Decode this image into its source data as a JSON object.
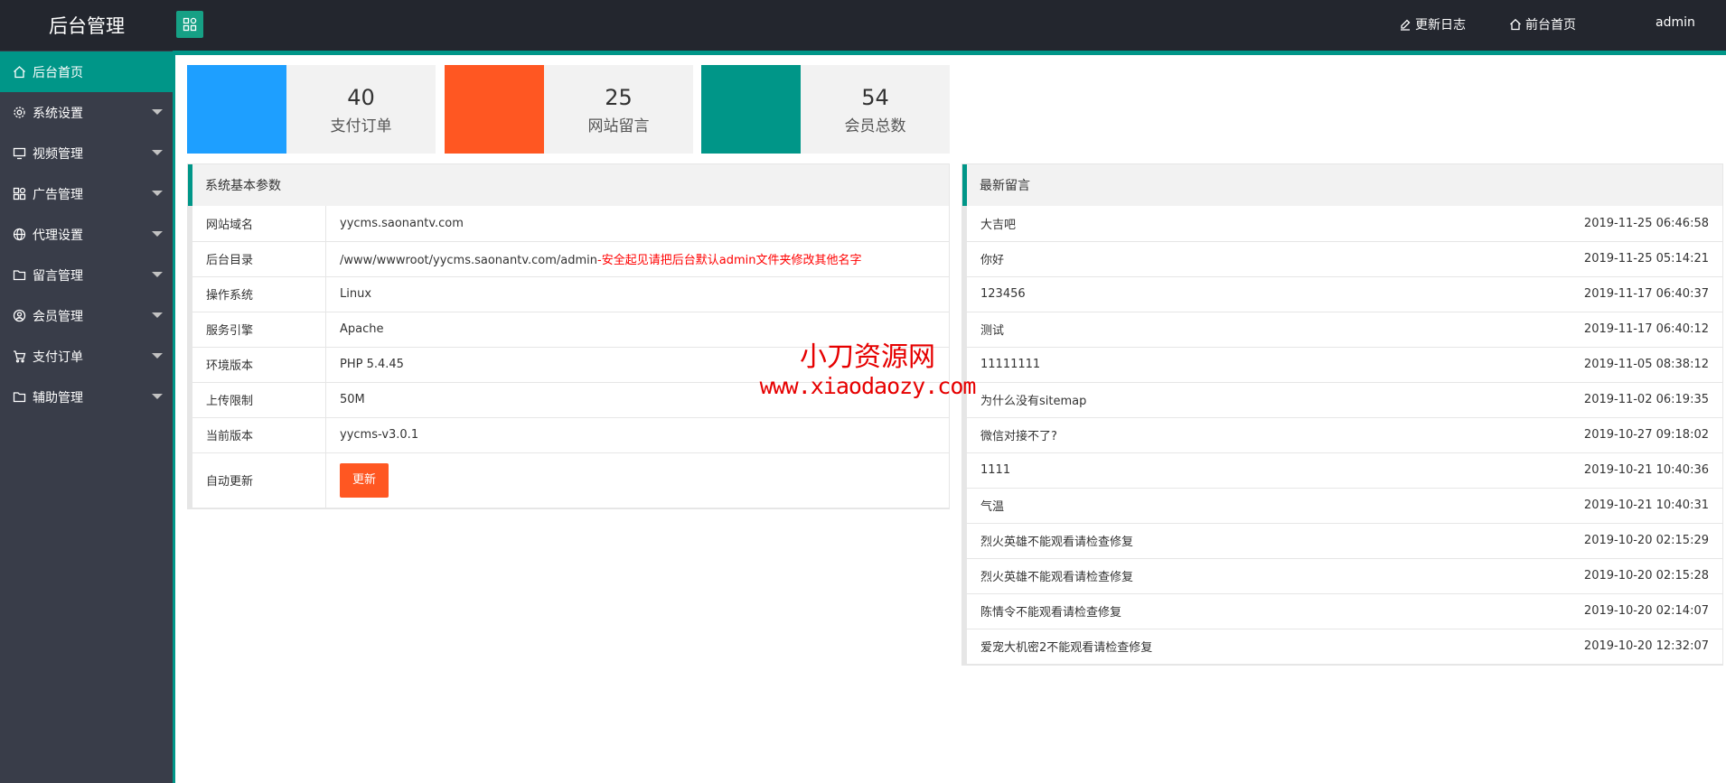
{
  "header": {
    "title": "后台管理",
    "links": [
      {
        "label": "更新日志",
        "icon": "edit-icon"
      },
      {
        "label": "前台首页",
        "icon": "home-icon"
      }
    ],
    "user": "admin"
  },
  "sidebar": {
    "items": [
      {
        "label": "后台首页",
        "icon": "home-icon",
        "active": true
      },
      {
        "label": "系统设置",
        "icon": "gear-icon"
      },
      {
        "label": "视频管理",
        "icon": "monitor-icon"
      },
      {
        "label": "广告管理",
        "icon": "apps-icon"
      },
      {
        "label": "代理设置",
        "icon": "globe-icon"
      },
      {
        "label": "留言管理",
        "icon": "folder-icon"
      },
      {
        "label": "会员管理",
        "icon": "user-icon"
      },
      {
        "label": "支付订单",
        "icon": "cart-icon"
      },
      {
        "label": "辅助管理",
        "icon": "folder-icon"
      }
    ]
  },
  "stats": [
    {
      "value": "40",
      "label": "支付订单",
      "color": "#1e9fff"
    },
    {
      "value": "25",
      "label": "网站留言",
      "color": "#ff5722"
    },
    {
      "value": "54",
      "label": "会员总数",
      "color": "#009688"
    }
  ],
  "sysinfo": {
    "title": "系统基本参数",
    "rows": [
      {
        "key": "网站域名",
        "value": "yycms.saonantv.com"
      },
      {
        "key": "后台目录",
        "value": "/www/wwwroot/yycms.saonantv.com/admin",
        "warning": "-安全起见请把后台默认admin文件夹修改其他名字"
      },
      {
        "key": "操作系统",
        "value": "Linux"
      },
      {
        "key": "服务引擎",
        "value": "Apache"
      },
      {
        "key": "环境版本",
        "value": "PHP 5.4.45"
      },
      {
        "key": "上传限制",
        "value": "50M"
      },
      {
        "key": "当前版本",
        "value": "yycms-v3.0.1"
      }
    ],
    "update_key": "自动更新",
    "update_button": "更新"
  },
  "messages": {
    "title": "最新留言",
    "rows": [
      {
        "text": "大吉吧",
        "time": "2019-11-25 06:46:58"
      },
      {
        "text": "你好",
        "time": "2019-11-25 05:14:21"
      },
      {
        "text": "123456",
        "time": "2019-11-17 06:40:37"
      },
      {
        "text": "测试",
        "time": "2019-11-17 06:40:12"
      },
      {
        "text": "11111111",
        "time": "2019-11-05 08:38:12"
      },
      {
        "text": "为什么没有sitemap",
        "time": "2019-11-02 06:19:35"
      },
      {
        "text": "微信对接不了?",
        "time": "2019-10-27 09:18:02"
      },
      {
        "text": "1111",
        "time": "2019-10-21 10:40:36"
      },
      {
        "text": "气温",
        "time": "2019-10-21 10:40:31"
      },
      {
        "text": "烈火英雄不能观看请检查修复",
        "time": "2019-10-20 02:15:29"
      },
      {
        "text": "烈火英雄不能观看请检查修复",
        "time": "2019-10-20 02:15:28"
      },
      {
        "text": "陈情令不能观看请检查修复",
        "time": "2019-10-20 02:14:07"
      },
      {
        "text": "爱宠大机密2不能观看请检查修复",
        "time": "2019-10-20 12:32:07"
      }
    ]
  },
  "watermark": {
    "line1": "小刀资源网",
    "line2": "www.xiaodaozy.com"
  }
}
